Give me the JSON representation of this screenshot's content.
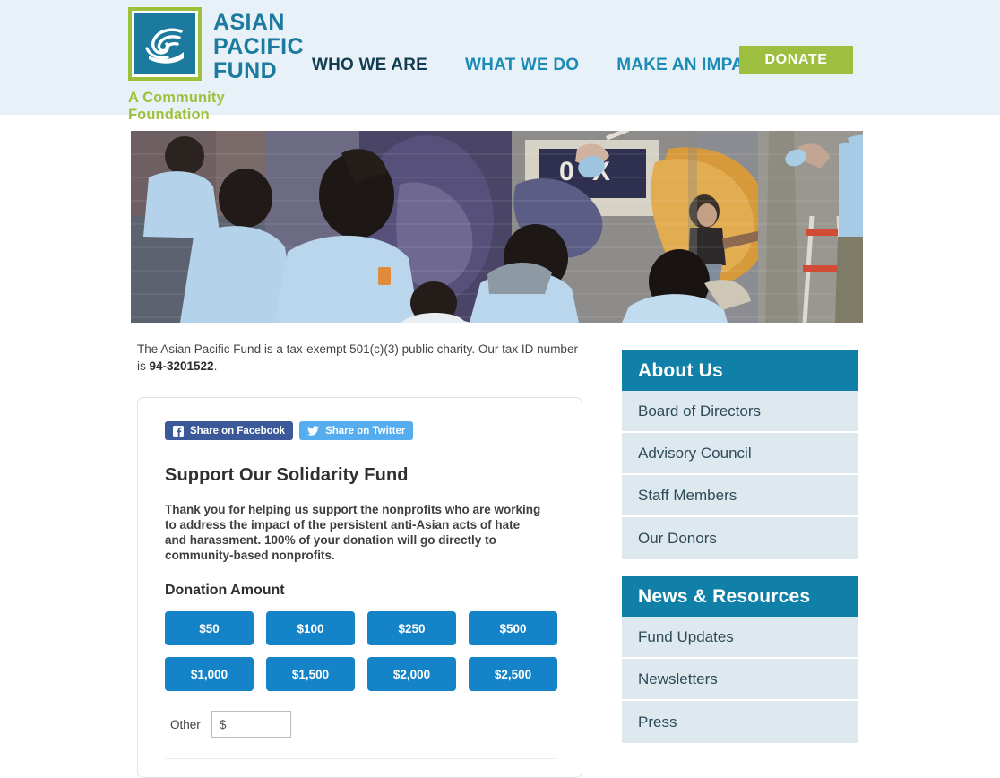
{
  "header": {
    "logo": {
      "icon": "wave-logo-icon",
      "line1": "ASIAN",
      "line2": "PACIFIC",
      "line3": "FUND",
      "tagline": "A Community Foundation",
      "mark_border_color": "#9ec13c",
      "mark_fill_color": "#1b7a9e",
      "wordmark_color": "#1b7a9e",
      "tagline_color": "#9ec13c"
    },
    "background_color": "#e7f1f7",
    "nav": [
      {
        "label": "WHO WE ARE",
        "active": true
      },
      {
        "label": "WHAT WE DO",
        "active": false
      },
      {
        "label": "MAKE AN IMPACT",
        "active": false
      }
    ],
    "nav_active_color": "#123c52",
    "nav_color": "#1b8bb5",
    "donate_label": "DONATE",
    "donate_color": "#9ebe3f"
  },
  "hero": {
    "alt": "Volunteers in light blue t-shirts painting a community mural on a brick wall",
    "mural_letters": "0 X"
  },
  "main": {
    "tax_note_prefix": "The Asian Pacific Fund is a tax-exempt 501(c)(3) public charity. Our tax ID number is ",
    "tax_id": "94-3201522",
    "tax_note_suffix": ".",
    "share": {
      "facebook_label": "Share on Facebook",
      "facebook_icon": "facebook-icon",
      "facebook_color": "#3b5998",
      "twitter_label": "Share on Twitter",
      "twitter_icon": "twitter-icon",
      "twitter_color": "#55acee"
    },
    "card": {
      "title": "Support Our Solidarity Fund",
      "description": "Thank you for helping us support the nonprofits who are working to address the impact of the persistent anti-Asian acts of hate and harassment. 100% of your donation will go directly to community-based nonprofits.",
      "amount_label": "Donation Amount",
      "amounts": [
        "$50",
        "$100",
        "$250",
        "$500",
        "$1,000",
        "$1,500",
        "$2,000",
        "$2,500"
      ],
      "amount_color": "#1583c8",
      "other_label": "Other",
      "other_value": "$",
      "other_placeholder": ""
    }
  },
  "sidebar": {
    "header_color": "#1180a8",
    "item_color": "#dde9ef",
    "widgets": [
      {
        "title": "About Us",
        "items": [
          "Board of Directors",
          "Advisory Council",
          "Staff Members",
          "Our Donors"
        ]
      },
      {
        "title": "News & Resources",
        "items": [
          "Fund Updates",
          "Newsletters",
          "Press"
        ]
      }
    ]
  }
}
